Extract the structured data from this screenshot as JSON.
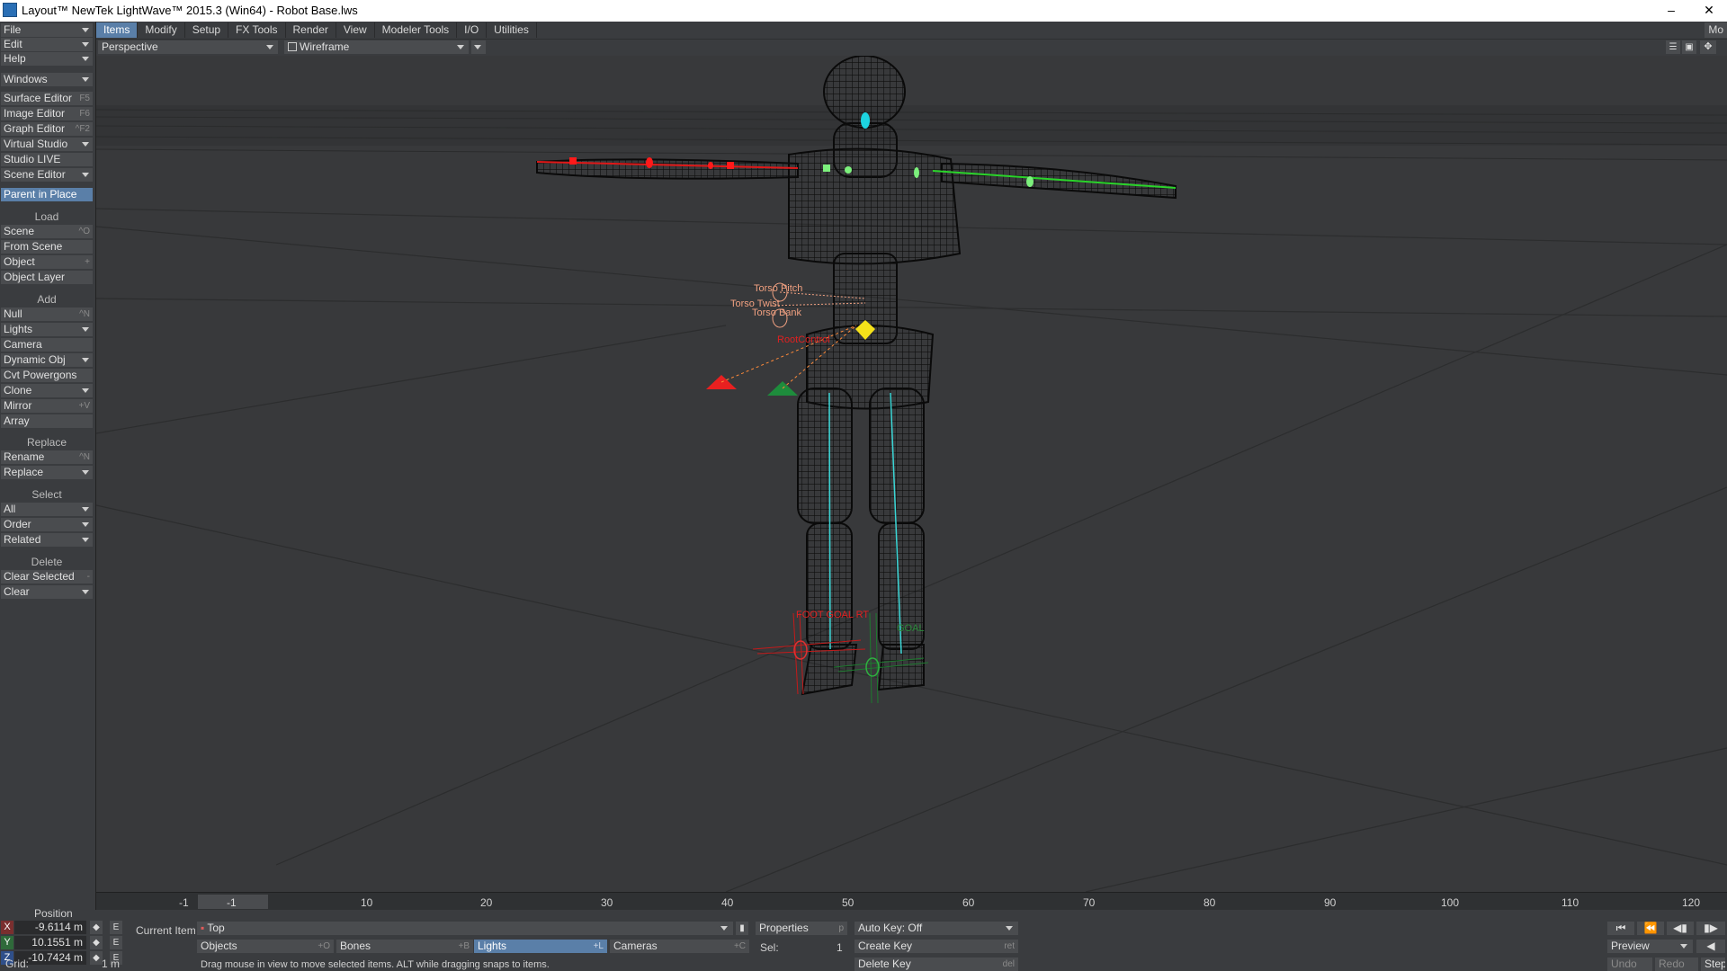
{
  "window": {
    "title": "Layout™ NewTek LightWave™ 2015.3 (Win64) - Robot Base.lws",
    "minimize": "–",
    "close": "✕"
  },
  "tabs": [
    "Items",
    "Modify",
    "Setup",
    "FX Tools",
    "Render",
    "View",
    "Modeler Tools",
    "I/O",
    "Utilities"
  ],
  "active_tab": "Items",
  "menubar_right": "Mo",
  "sidebar": {
    "file": "File",
    "edit": "Edit",
    "help": "Help",
    "windows": "Windows",
    "surface_editor": "Surface Editor",
    "surface_editor_sc": "F5",
    "image_editor": "Image Editor",
    "image_editor_sc": "F6",
    "graph_editor": "Graph Editor",
    "graph_editor_sc": "^F2",
    "virtual_studio": "Virtual Studio",
    "studio_live": "Studio LIVE",
    "scene_editor": "Scene Editor",
    "parent_in_place": "Parent in Place",
    "load_header": "Load",
    "scene": "Scene",
    "scene_sc": "^O",
    "from_scene": "From Scene",
    "object": "Object",
    "object_sc": "+",
    "object_layer": "Object Layer",
    "add_header": "Add",
    "null": "Null",
    "null_sc": "^N",
    "lights": "Lights",
    "camera": "Camera",
    "dynamic_obj": "Dynamic Obj",
    "cvt_powergons": "Cvt Powergons",
    "clone": "Clone",
    "mirror": "Mirror",
    "mirror_sc": "+V",
    "array": "Array",
    "replace_header": "Replace",
    "rename": "Rename",
    "rename_sc": "^N",
    "replace": "Replace",
    "select_header": "Select",
    "all": "All",
    "order": "Order",
    "related": "Related",
    "delete_header": "Delete",
    "clear_selected": "Clear Selected",
    "clear_selected_sc": "-",
    "clear": "Clear"
  },
  "viewport_header": {
    "view_mode": "Perspective",
    "render_mode": "Wireframe"
  },
  "viewport_labels": {
    "torso_pitch": "Torso Pitch",
    "torso_twist": "Torso Twist",
    "torso_bank": "Torso Bank",
    "root_control": "RootControl",
    "foot_goal_rt": "FOOT GOAL RT",
    "foot_goal_lt": "GOAL"
  },
  "timeline": {
    "start": "-1",
    "current": "-1",
    "ticks": [
      "10",
      "20",
      "30",
      "40",
      "50",
      "60",
      "70",
      "80",
      "90",
      "100",
      "110",
      "120"
    ]
  },
  "bottom": {
    "position_label": "Position",
    "x_axis": "X",
    "y_axis": "Y",
    "z_axis": "Z",
    "x_value": "-9.6114 m",
    "y_value": "10.1551 m",
    "z_value": "-10.7424 m",
    "e_label": "E",
    "grid_label": "Grid:",
    "grid_value": "1 m",
    "current_item_label": "Current Item",
    "current_item": "Top",
    "objects": "Objects",
    "objects_sc": "+O",
    "bones": "Bones",
    "bones_sc": "+B",
    "lights": "Lights",
    "lights_sc": "+L",
    "cameras": "Cameras",
    "cameras_sc": "+C",
    "properties": "Properties",
    "properties_sc": "p",
    "sel_label": "Sel:",
    "sel_value": "1",
    "auto_key": "Auto Key: Off",
    "create_key": "Create Key",
    "create_key_sc": "ret",
    "delete_key": "Delete Key",
    "delete_key_sc": "del",
    "status": "Drag mouse in view to move selected items. ALT while dragging snaps to items.",
    "preview": "Preview",
    "undo": "Undo",
    "redo": "Redo",
    "step": "Step"
  },
  "colors": {
    "accent": "#5a7fa8",
    "panel": "#3a3c3f",
    "button": "#4a4c4f",
    "viewport": "#38393b",
    "x_axis": "#7a2f2f",
    "y_axis": "#2f6a3a",
    "z_axis": "#2f4f8a"
  }
}
